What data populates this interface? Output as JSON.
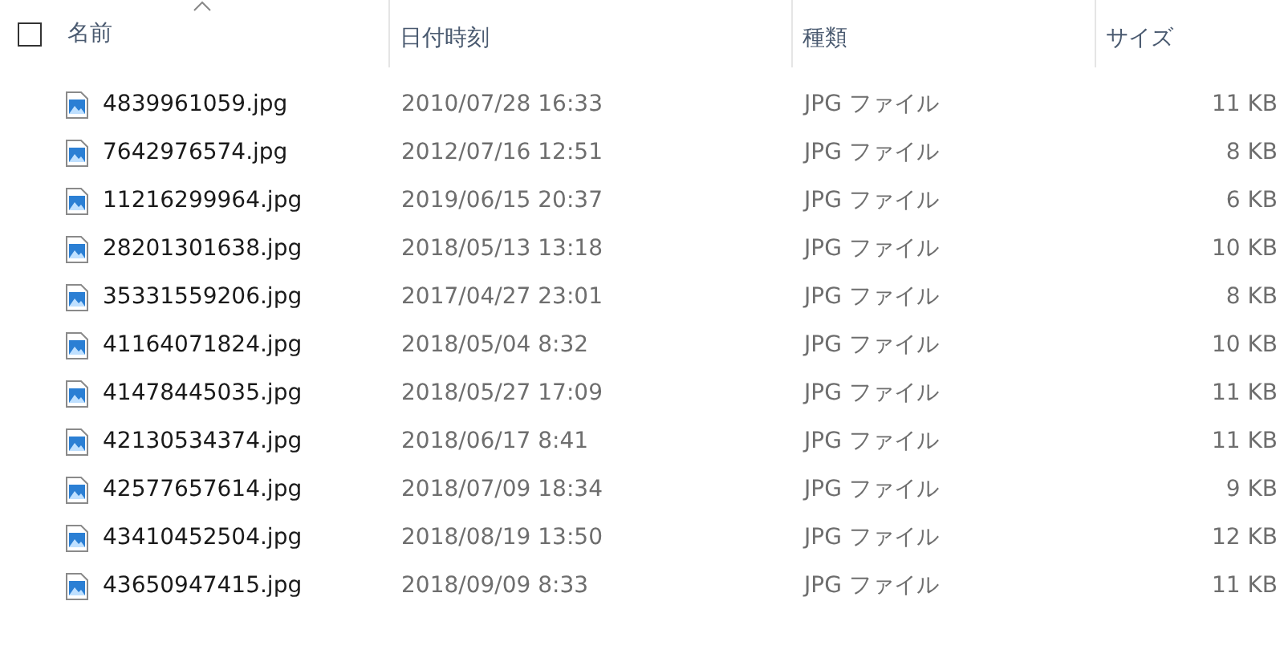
{
  "select_all": {
    "checked": false
  },
  "columns": [
    {
      "label": "名前",
      "sorted": true
    },
    {
      "label": "日付時刻",
      "sorted": false
    },
    {
      "label": "種類",
      "sorted": false
    },
    {
      "label": "サイズ",
      "sorted": false
    }
  ],
  "rows": [
    {
      "name": "4839961059.jpg",
      "date": "2010/07/28 16:33",
      "type": "JPG ファイル",
      "size": "11 KB"
    },
    {
      "name": "7642976574.jpg",
      "date": "2012/07/16 12:51",
      "type": "JPG ファイル",
      "size": "8 KB"
    },
    {
      "name": "11216299964.jpg",
      "date": "2019/06/15 20:37",
      "type": "JPG ファイル",
      "size": "6 KB"
    },
    {
      "name": "28201301638.jpg",
      "date": "2018/05/13 13:18",
      "type": "JPG ファイル",
      "size": "10 KB"
    },
    {
      "name": "35331559206.jpg",
      "date": "2017/04/27 23:01",
      "type": "JPG ファイル",
      "size": "8 KB"
    },
    {
      "name": "41164071824.jpg",
      "date": "2018/05/04 8:32",
      "type": "JPG ファイル",
      "size": "10 KB"
    },
    {
      "name": "41478445035.jpg",
      "date": "2018/05/27 17:09",
      "type": "JPG ファイル",
      "size": "11 KB"
    },
    {
      "name": "42130534374.jpg",
      "date": "2018/06/17 8:41",
      "type": "JPG ファイル",
      "size": "11 KB"
    },
    {
      "name": "42577657614.jpg",
      "date": "2018/07/09 18:34",
      "type": "JPG ファイル",
      "size": "9 KB"
    },
    {
      "name": "43410452504.jpg",
      "date": "2018/08/19 13:50",
      "type": "JPG ファイル",
      "size": "12 KB"
    },
    {
      "name": "43650947415.jpg",
      "date": "2018/09/09 8:33",
      "type": "JPG ファイル",
      "size": "11 KB"
    }
  ]
}
